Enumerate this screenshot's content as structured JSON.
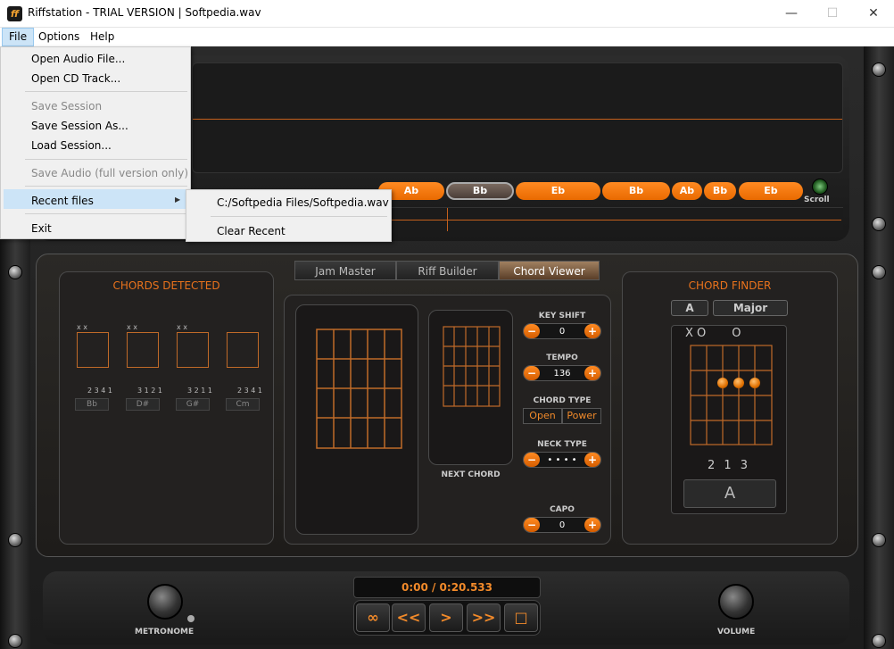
{
  "window": {
    "title": "Riffstation - TRIAL VERSION | Softpedia.wav",
    "app_icon": "ff",
    "minimize": "—",
    "maximize": "☐",
    "close": "✕"
  },
  "menubar": {
    "file": "File",
    "options": "Options",
    "help": "Help"
  },
  "file_menu": {
    "items": [
      {
        "label": "Open Audio File...",
        "enabled": true
      },
      {
        "label": "Open CD Track...",
        "enabled": true
      },
      {
        "label": "Save Session",
        "enabled": false
      },
      {
        "label": "Save Session As...",
        "enabled": true
      },
      {
        "label": "Load Session...",
        "enabled": true
      },
      {
        "label": "Save Audio (full version only)",
        "enabled": false
      },
      {
        "label": "Recent files",
        "enabled": true,
        "highlighted": true,
        "submenu_arrow": "▶"
      },
      {
        "label": "Exit",
        "enabled": true
      }
    ]
  },
  "recent_submenu": {
    "items": [
      "C:/Softpedia Files/Softpedia.wav",
      "Clear Recent"
    ]
  },
  "chord_strip": {
    "chords": [
      "Ab",
      "Bb",
      "Eb",
      "Bb",
      "Ab",
      "Bb",
      "Eb"
    ],
    "selected": "Bb",
    "scroll_label": "Scroll"
  },
  "tabs": [
    "Jam Master",
    "Riff Builder",
    "Chord Viewer"
  ],
  "active_tab": "Chord Viewer",
  "chords_detected": {
    "title": "CHORDS DETECTED",
    "chords": [
      {
        "name": "Bb",
        "fingering": "2 3 4 1",
        "top": "x x"
      },
      {
        "name": "D#",
        "fingering": "3 1 2 1",
        "top": "x x"
      },
      {
        "name": "G#",
        "fingering": "3 2 1 1",
        "top": "x x"
      },
      {
        "name": "Cm",
        "fingering": "2 3 4 1",
        "top": ""
      }
    ]
  },
  "next_chord_label": "NEXT CHORD",
  "controls": {
    "key_shift": {
      "label": "KEY SHIFT",
      "value": "0"
    },
    "tempo": {
      "label": "TEMPO",
      "value": "136"
    },
    "chord_type": {
      "label": "CHORD TYPE",
      "options": [
        "Open",
        "Power"
      ]
    },
    "neck_type": {
      "label": "NECK TYPE",
      "value": "• • • •"
    },
    "capo": {
      "label": "CAPO",
      "value": "0"
    },
    "minus": "−",
    "plus": "+"
  },
  "chord_finder": {
    "title": "CHORD FINDER",
    "root": "A",
    "quality": "Major",
    "open_strings": "X O       O",
    "fingering": "2 1 3",
    "chord_name": "A"
  },
  "transport": {
    "time": "0:00 / 0:20.533",
    "buttons": [
      "∞",
      "<<",
      ">",
      ">>",
      "□"
    ]
  },
  "metronome_label": "METRONOME",
  "volume_label": "VOLUME",
  "colors": {
    "accent": "#e96a00",
    "menu_highlight": "#cce4f7"
  }
}
